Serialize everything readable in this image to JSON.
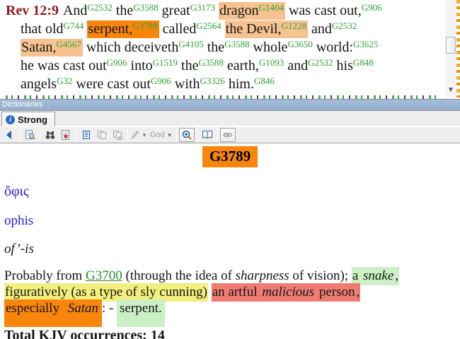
{
  "bible": {
    "lines": [
      {
        "indent": false,
        "ref": "Rev 12:9",
        "words": [
          {
            "t": "And",
            "s": "G2532"
          },
          {
            "t": "the",
            "s": "G3588"
          },
          {
            "t": "great",
            "s": "G3173"
          },
          {
            "t": "dragon",
            "s": "G1404",
            "hl": "peach"
          },
          {
            "t": "was cast out,",
            "s": "G906"
          }
        ]
      },
      {
        "indent": true,
        "words": [
          {
            "t": "that old",
            "s": "G744"
          },
          {
            "t": "serpent,",
            "s": "G3789",
            "hl": "orange"
          },
          {
            "t": "called",
            "s": "G2564"
          },
          {
            "t": "the Devil,",
            "s": "G1228",
            "hl": "peach"
          },
          {
            "t": "and",
            "s": "G2532"
          }
        ]
      },
      {
        "indent": true,
        "words": [
          {
            "t": "Satan,",
            "s": "G4567",
            "hl": "peach"
          },
          {
            "t": "which deceiveth",
            "s": "G4105"
          },
          {
            "t": "the",
            "s": "G3588"
          },
          {
            "t": "whole",
            "s": "G3650"
          },
          {
            "t": "world:",
            "s": "G3625"
          }
        ]
      },
      {
        "indent": true,
        "words": [
          {
            "t": "he was cast out",
            "s": "G906"
          },
          {
            "t": "into",
            "s": "G1519"
          },
          {
            "t": "the",
            "s": "G3588"
          },
          {
            "t": "earth,",
            "s": "G1093"
          },
          {
            "t": "and",
            "s": "G2532"
          },
          {
            "t": "his",
            "s": "G848"
          }
        ]
      },
      {
        "indent": true,
        "words": [
          {
            "t": "angels",
            "s": "G32"
          },
          {
            "t": "were cast out",
            "s": "G906"
          },
          {
            "t": "with",
            "s": "G3326"
          },
          {
            "t": "him.",
            "s": "G846"
          }
        ]
      }
    ]
  },
  "dict_panel": {
    "title": "Dictionaries",
    "tab": "Strong",
    "toolbar": {
      "items": [
        {
          "type": "button",
          "name": "back-button",
          "icon": "arrow-left-icon"
        },
        {
          "type": "sep"
        },
        {
          "type": "button",
          "name": "dictionary-lookup-button",
          "icon": "page-find-icon"
        },
        {
          "type": "sep"
        },
        {
          "type": "button",
          "name": "search-button",
          "icon": "binoculars-icon"
        },
        {
          "type": "button",
          "name": "verse-list-button",
          "icon": "page-star-icon"
        },
        {
          "type": "sep"
        },
        {
          "type": "button",
          "name": "study-notes-button",
          "icon": "notes-icon"
        },
        {
          "type": "button",
          "name": "copy-button",
          "icon": "copy-icon",
          "disabled": true
        },
        {
          "type": "button",
          "name": "copy-verses-button",
          "icon": "copy-plus-icon",
          "disabled": true
        },
        {
          "type": "sep"
        },
        {
          "type": "button",
          "name": "highlighter-button",
          "icon": "marker-icon",
          "disabled": true,
          "dropdown": true
        },
        {
          "type": "dropdown",
          "name": "resource-selector",
          "label": "God",
          "disabled": true
        },
        {
          "type": "sep"
        },
        {
          "type": "button",
          "name": "zoom-button",
          "icon": "zoom-in-icon",
          "active": true
        },
        {
          "type": "sep"
        },
        {
          "type": "button",
          "name": "compare-button",
          "icon": "book-open-icon"
        },
        {
          "type": "sep"
        },
        {
          "type": "button",
          "name": "link-button",
          "icon": "link-icon",
          "active": true
        }
      ]
    },
    "entry": {
      "number": "G3789",
      "greek": "ὄφις",
      "translit": "ophis",
      "pronunciation": "of’-is",
      "definition_lines": [
        [
          {
            "t": "Probably from "
          },
          {
            "t": "G3700",
            "link": true
          },
          {
            "t": " (through the idea of "
          },
          {
            "t": "sharpness",
            "i": true
          },
          {
            "t": " of vision); "
          },
          {
            "t": "a ",
            "hl": "green"
          },
          {
            "t": "snake",
            "i": true,
            "hl": "green"
          },
          {
            "t": ",",
            "hl": "green"
          }
        ],
        [
          {
            "t": "figuratively (as a type of sly cunning)",
            "hl": "yellow"
          },
          {
            "t": " "
          },
          {
            "t": "an artful ",
            "hl": "red"
          },
          {
            "t": "malicious",
            "i": true,
            "hl": "red"
          },
          {
            "t": " person",
            "hl": "red"
          },
          {
            "t": ",",
            "hl": "red"
          }
        ],
        [
          {
            "t": "especially ",
            "hl": "orange-tall"
          },
          {
            "t": "Satan",
            "i": true,
            "hl": "orange-tall"
          },
          {
            "t": ": - "
          },
          {
            "t": "serpent.",
            "hl": "green-tall"
          }
        ]
      ],
      "total_label": "Total KJV occurrences:",
      "total_value": "14"
    }
  },
  "colors": {
    "verse_ref": "#92191C",
    "strong_number": "#2FA032",
    "highlight_peach": "#F6C28F",
    "highlight_orange": "#F8860D",
    "highlight_yellow": "#F2EF7D",
    "highlight_light_green": "#CBF0C6",
    "highlight_red": "#EF7C72",
    "greek_blue": "#2020E0",
    "panel_header_blue": "#9AB3D4"
  }
}
